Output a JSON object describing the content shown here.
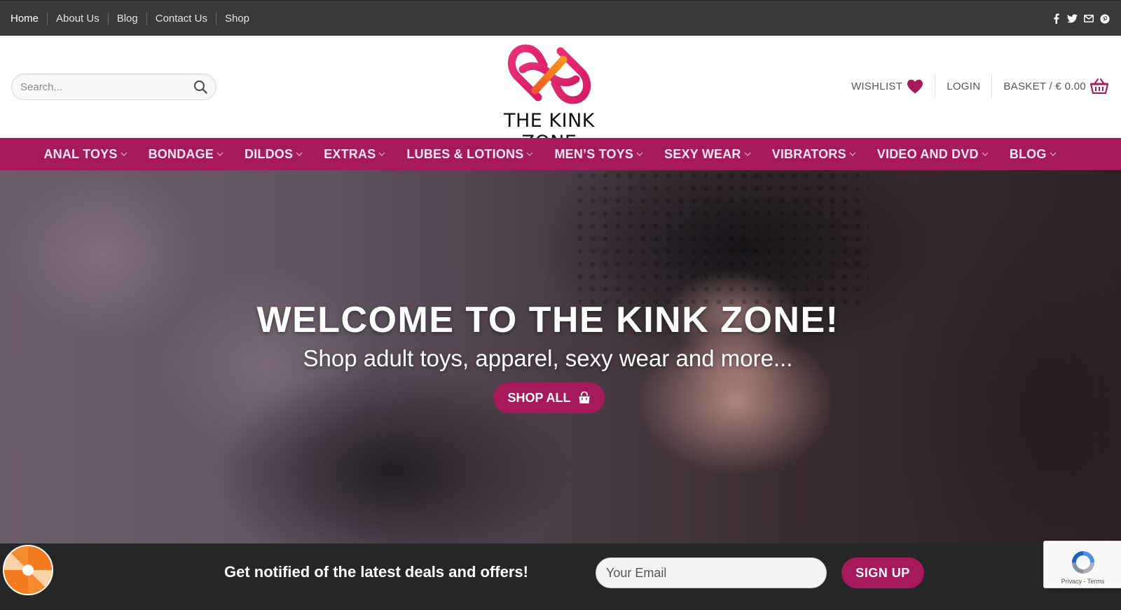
{
  "topbar": {
    "links": [
      "Home",
      "About Us",
      "Blog",
      "Contact Us",
      "Shop"
    ],
    "social_icons": [
      "facebook-icon",
      "twitter-icon",
      "email-icon",
      "pinterest-icon"
    ]
  },
  "header": {
    "search_placeholder": "Search...",
    "logo_text": "THE KINK ZONE",
    "wishlist_label": "WISHLIST",
    "login_label": "LOGIN",
    "basket_label": "BASKET / € 0.00"
  },
  "nav": {
    "items": [
      "ANAL TOYS",
      "BONDAGE",
      "DILDOS",
      "EXTRAS",
      "LUBES & LOTIONS",
      "MEN’S TOYS",
      "SEXY WEAR",
      "VIBRATORS",
      "VIDEO AND DVD",
      "BLOG"
    ]
  },
  "hero": {
    "title": "WELCOME TO THE KINK ZONE!",
    "subtitle": "Shop adult toys, apparel, sexy wear and more...",
    "button_label": "SHOP ALL"
  },
  "newsletter": {
    "text": "Get notified of the latest deals and offers!",
    "email_placeholder": "Your Email",
    "button_label": "SIGN UP"
  },
  "recaptcha": {
    "text": "Privacy - Terms"
  },
  "colors": {
    "brand": "#a6195a",
    "topbar": "#3a3a3a",
    "footer": "#262626",
    "logo_orange": "#f26a2a"
  }
}
